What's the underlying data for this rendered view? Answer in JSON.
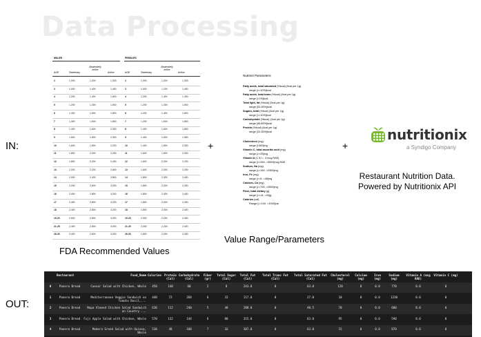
{
  "title": "Data Processing",
  "labels": {
    "in": "IN:",
    "out": "OUT:",
    "plus": "+"
  },
  "fda": {
    "caption": "FDA Recommended Values",
    "males": "MALES",
    "females": "FEMALES",
    "col_age": "AGE",
    "col_sedentary": "Sedentary",
    "col_moderate": "Moderately active",
    "col_active": "Active",
    "rows": [
      [
        "2",
        "1,000",
        "1,000",
        "1,000",
        "2",
        "1,000",
        "1,000",
        "1,000"
      ],
      [
        "3",
        "1,000",
        "1,400",
        "1,400",
        "3",
        "1,000",
        "1,200",
        "1,400"
      ],
      [
        "4",
        "1,200",
        "1,400",
        "1,600",
        "4",
        "1,200",
        "1,400",
        "1,400"
      ],
      [
        "5",
        "1,200",
        "1,400",
        "1,600",
        "5",
        "1,200",
        "1,400",
        "1,600"
      ],
      [
        "6",
        "1,400",
        "1,600",
        "1,800",
        "6",
        "1,200",
        "1,400",
        "1,600"
      ],
      [
        "7",
        "1,400",
        "1,600",
        "1,800",
        "7",
        "1,200",
        "1,600",
        "1,800"
      ],
      [
        "8",
        "1,400",
        "1,600",
        "2,000",
        "8",
        "1,400",
        "1,600",
        "1,800"
      ],
      [
        "9",
        "1,600",
        "1,800",
        "2,000",
        "9",
        "1,400",
        "1,600",
        "1,800"
      ],
      [
        "10",
        "1,600",
        "1,800",
        "2,200",
        "10",
        "1,400",
        "1,800",
        "2,000"
      ],
      [
        "11",
        "1,800",
        "2,000",
        "2,200",
        "11",
        "1,600",
        "1,800",
        "2,000"
      ],
      [
        "12",
        "1,800",
        "2,200",
        "2,400",
        "12",
        "1,600",
        "2,000",
        "2,200"
      ],
      [
        "13",
        "2,000",
        "2,200",
        "2,600",
        "13",
        "1,600",
        "2,000",
        "2,200"
      ],
      [
        "14",
        "2,000",
        "2,400",
        "2,800",
        "14",
        "1,800",
        "2,000",
        "2,400"
      ],
      [
        "15",
        "2,200",
        "2,600",
        "3,000",
        "15",
        "1,800",
        "2,000",
        "2,400"
      ],
      [
        "16",
        "2,400",
        "2,800",
        "3,200",
        "16",
        "1,800",
        "2,000",
        "2,400"
      ],
      [
        "17",
        "2,400",
        "2,800",
        "3,200",
        "17",
        "1,800",
        "2,000",
        "2,400"
      ],
      [
        "18",
        "2,400",
        "2,800",
        "3,200",
        "18",
        "1,800",
        "2,000",
        "2,400"
      ],
      [
        "19-20",
        "2,600",
        "2,800",
        "3,000",
        "19-20",
        "2,000",
        "2,200",
        "2,400"
      ],
      [
        "21-25",
        "2,400",
        "2,800",
        "3,000",
        "21-25",
        "2,000",
        "2,200",
        "2,400"
      ],
      [
        "26-30",
        "2,400",
        "2,600",
        "3,000",
        "26-30",
        "1,800",
        "2,000",
        "2,400"
      ]
    ]
  },
  "params": {
    "caption": "Value Range/Parameters",
    "heading": "Nutrient Parameters:",
    "lines": [
      [
        "Fatty acids, total saturated",
        " (%kcal) (9cal per 1g)"
      ],
      [
        "",
        "range [<=10%]kcal"
      ],
      [
        "Fatty acids, total trans",
        " (%kcal) (9cal per 1g)"
      ],
      [
        "",
        "range [<1%]kcal"
      ],
      [
        "Total lipid, fat",
        " (%kcal) (9cal per 1g)"
      ],
      [
        "",
        "range [20-35%]kcal"
      ],
      [
        "Sugars, total",
        " (%kcal) (4cal per 1g)"
      ],
      [
        "",
        "range [<=10%]kcal"
      ],
      [
        "Carbohydrate",
        " (%kcal) (4cal per 1g)"
      ],
      [
        "",
        "range [45-65%]kcal"
      ],
      [
        "Protein",
        " (%kcal) (4cal per 1g)"
      ],
      [
        "",
        "range [10-35%]kcal"
      ],
      [
        "",
        ""
      ],
      [
        "Cholesterol",
        " (mg)"
      ],
      [
        "",
        "range [<300]mg"
      ],
      [
        "Vitamin C, total ascorbic acid",
        " (mg)"
      ],
      [
        "",
        "range [>=25]mg"
      ],
      [
        "Vitamin A",
        " (1 IU = .3 mcg RAE)"
      ],
      [
        "",
        "range [>=250, <3000]mcg RAE"
      ],
      [
        "Sodium, Na",
        " (mg)"
      ],
      [
        "",
        "range [>=150, <2300]mg"
      ],
      [
        "Iron, Fe",
        " (mg)"
      ],
      [
        "",
        "range [>=5, <45]mg"
      ],
      [
        "Calcium, Ca",
        " (mg)"
      ],
      [
        "",
        "range [>=700, <2500]mg"
      ],
      [
        "Fiber, total dietary",
        " (g)"
      ],
      [
        "",
        "range [>=14, <34]g"
      ],
      [
        "Calories",
        " (cal)"
      ],
      [
        "",
        "Range [>=100, <1000]cal"
      ]
    ]
  },
  "nutritionix": {
    "word": "nutritionix",
    "sub": "a Syndigo Company",
    "caption_1": "Restaurant Nutrition Data.",
    "caption_2": "Powered by Nutritionix API",
    "brand_green": "#7ab733"
  },
  "output": {
    "columns": [
      "",
      "Restaurant",
      "Food_Name",
      "Calories",
      "Protein (Cal)",
      "Carbohydrate (Cal)",
      "Fiber (gr)",
      "Total Sugar (Cal)",
      "Total Fat (Cal)",
      "Total Trans Fat (Cal)",
      "Total Saturated Fat (Cal)",
      "Cholesterol (mg)",
      "Calcium (mg)",
      "Iron (mg)",
      "Sodium (mg)",
      "Vitamin A (mcg RAE)",
      "Vitamin C (mg)"
    ],
    "rows": [
      [
        "0",
        "Panera Bread",
        "Caesar Salad with Chicken, Whole",
        "450",
        "148",
        "60",
        "2",
        "8",
        "243.0",
        "0",
        "63.0",
        "120",
        "0",
        "0.0",
        "770",
        "0.0",
        "0"
      ],
      [
        "1",
        "Panera Bread",
        "Mediterranean Veggie Sandwich on Tomato Basil,...",
        "440",
        "72",
        "268",
        "6",
        "32",
        "117.0",
        "0",
        "27.0",
        "10",
        "0",
        "0.0",
        "1230",
        "0.0",
        "0"
      ],
      [
        "2",
        "Panera Bread",
        "Napa Almond Chicken Salad Sandwich on Country ...",
        "630",
        "112",
        "240",
        "5",
        "48",
        "288.0",
        "0",
        "40.5",
        "70",
        "0",
        "0.0",
        "680",
        "0.0",
        "0"
      ],
      [
        "3",
        "Panera Bread",
        "Fuji Apple Salad with Chicken, Whole",
        "570",
        "132",
        "144",
        "6",
        "80",
        "315.0",
        "0",
        "63.0",
        "95",
        "0",
        "0.0",
        "590",
        "0.0",
        "0"
      ],
      [
        "4",
        "Panera Bread",
        "Modern Greek Salad with Quinoa, Whole",
        "530",
        "48",
        "108",
        "7",
        "16",
        "387.0",
        "0",
        "63.0",
        "15",
        "0",
        "0.0",
        "870",
        "0.0",
        "0"
      ]
    ]
  }
}
